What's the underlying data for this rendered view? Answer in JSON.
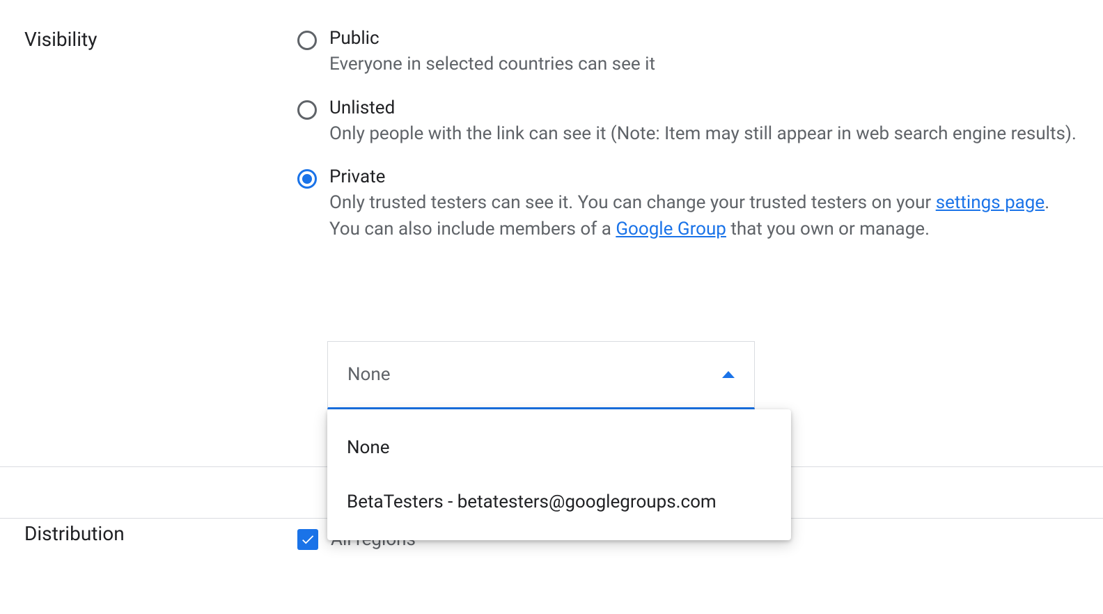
{
  "visibility": {
    "label": "Visibility",
    "options": [
      {
        "title": "Public",
        "desc": "Everyone in selected countries can see it",
        "selected": false
      },
      {
        "title": "Unlisted",
        "desc": "Only people with the link can see it (Note: Item may still appear in web search engine results).",
        "selected": false
      },
      {
        "title": "Private",
        "desc_pre": "Only trusted testers can see it. You can change your trusted testers on your ",
        "link1": "settings page",
        "desc_mid": ".",
        "desc_line2_pre": "You can also include members of a ",
        "link2": "Google Group",
        "desc_line2_post": " that you own or manage.",
        "selected": true
      }
    ],
    "select": {
      "value": "None",
      "options": [
        "None",
        "BetaTesters - betatesters@googlegroups.com"
      ]
    }
  },
  "distribution": {
    "label": "Distribution",
    "checkbox_label": "All regions"
  }
}
